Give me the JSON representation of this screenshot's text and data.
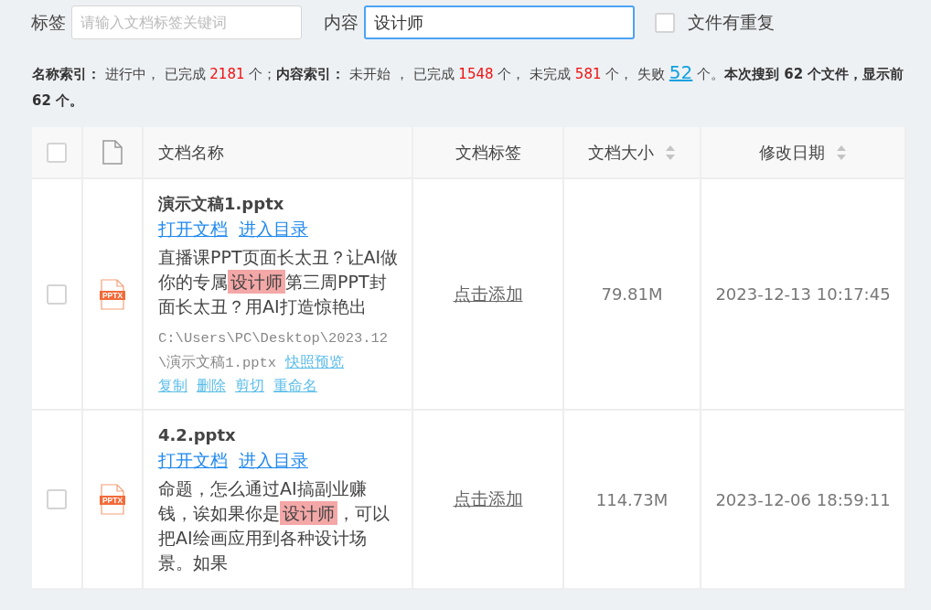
{
  "filters": {
    "tag_label": "标签",
    "tag_placeholder": "请输入文档标签关键词",
    "content_label": "内容",
    "content_value": "设计师",
    "duplicate": {
      "label": "文件有重复",
      "checked": false
    }
  },
  "status": [
    {
      "kind": "label",
      "text": "名称索引："
    },
    {
      "kind": "text",
      "text": " 进行中， 已完成 "
    },
    {
      "kind": "count",
      "text": "2181"
    },
    {
      "kind": "text",
      "text": " 个；"
    },
    {
      "kind": "label",
      "text": "内容索引："
    },
    {
      "kind": "text",
      "text": " 未开始 ， 已完成 "
    },
    {
      "kind": "count",
      "text": "1548"
    },
    {
      "kind": "text",
      "text": " 个， 未完成 "
    },
    {
      "kind": "count",
      "text": "581"
    },
    {
      "kind": "text",
      "text": " 个， 失败 "
    },
    {
      "kind": "link",
      "text": "52"
    },
    {
      "kind": "text",
      "text": " 个。"
    },
    {
      "kind": "label",
      "text": "本次搜到 62 个文件，显示前 62 个。"
    }
  ],
  "table": {
    "select_all": {
      "checked": false
    },
    "columns": [
      {
        "label": "文档名称",
        "sortable": false
      },
      {
        "label": "文档标签",
        "sortable": false
      },
      {
        "label": "文档大小",
        "sortable": true
      },
      {
        "label": "修改日期",
        "sortable": true
      }
    ],
    "rows": [
      {
        "checked": false,
        "file_type": "PPTX",
        "name": "演示文稿1.pptx",
        "links": [
          "打开文档",
          "进入目录"
        ],
        "snippet_before": "直播课PPT页面长太丑？让AI做你的专属",
        "highlight": "设计师",
        "snippet_after": "第三周PPT封面长太丑？用AI打造惊艳出",
        "path": "C:\\Users\\PC\\Desktop\\2023.12\\演示文稿1.pptx",
        "actions": [
          "快照预览",
          "复制",
          "删除",
          "剪切",
          "重命名"
        ],
        "tag": "点击添加",
        "size": "79.81M",
        "modified": "2023-12-13 10:17:45"
      },
      {
        "checked": false,
        "file_type": "PPTX",
        "name": "4.2.pptx",
        "links": [
          "打开文档",
          "进入目录"
        ],
        "snippet_before": "命题，怎么通过AI搞副业赚钱，诶如果你是",
        "highlight": "设计师",
        "snippet_after": "，可以把AI绘画应用到各种设计场景。如果",
        "tag": "点击添加",
        "size": "114.73M",
        "modified": "2023-12-06 18:59:11"
      }
    ]
  }
}
